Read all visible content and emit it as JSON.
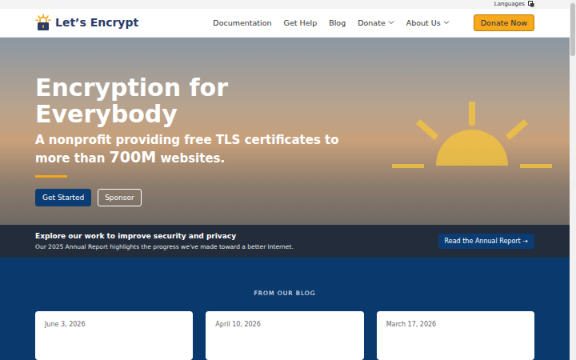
{
  "top_bar": {
    "languages": "Languages"
  },
  "logo": {
    "text": "Let’s Encrypt"
  },
  "nav": [
    {
      "label": "Documentation",
      "dropdown": false
    },
    {
      "label": "Get Help",
      "dropdown": false
    },
    {
      "label": "Blog",
      "dropdown": false
    },
    {
      "label": "Donate",
      "dropdown": true
    },
    {
      "label": "About Us",
      "dropdown": true
    }
  ],
  "donate_button": "Donate Now",
  "hero": {
    "title": "Encryption for Everybody",
    "subtitle_before": "A nonprofit providing free TLS certificates to more than ",
    "subtitle_highlight": "700M",
    "subtitle_after": " websites.",
    "buttons": [
      {
        "label": "Get Started",
        "kind": "primary"
      },
      {
        "label": "Sponsor",
        "kind": "outline"
      }
    ]
  },
  "report_banner": {
    "title": "Explore our work to improve security and privacy",
    "text": "Our 2025 Annual Report highlights the progress we've made toward a better Internet.",
    "button": "Read the Annual Report →"
  },
  "blog": {
    "heading": "FROM OUR BLOG",
    "posts": [
      {
        "date": "June 3, 2026"
      },
      {
        "date": "April 10, 2026"
      },
      {
        "date": "March 17, 2026"
      }
    ]
  }
}
